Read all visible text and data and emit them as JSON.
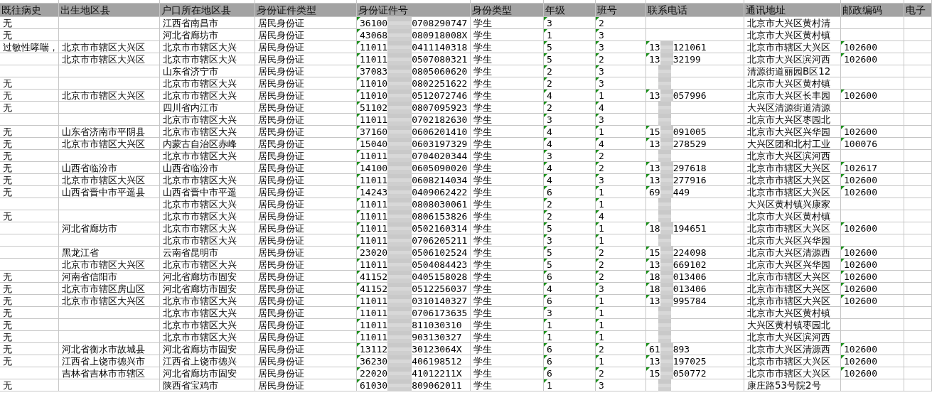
{
  "columns": [
    "既往病史",
    "出生地区县",
    "户口所在地区县",
    "身份证件类型",
    "身份证件号",
    "身份类型",
    "年级",
    "班号",
    "联系电话",
    "通讯地址",
    "邮政编码",
    "电子"
  ],
  "rows": [
    {
      "history": "无",
      "residence": "江西省南昌市",
      "id_type": "居民身份证",
      "id": {
        "prefix": "36100",
        "suffix": "0708290747"
      },
      "person_type": "学生",
      "grade": "3",
      "class": "2",
      "address": "北京市大兴区黄村清"
    },
    {
      "history": "无",
      "residence": "河北省廊坊市",
      "id_type": "居民身份证",
      "id": {
        "prefix": "43068",
        "suffix": "080918008X"
      },
      "person_type": "学生",
      "grade": "1",
      "class": "3",
      "address": "北京市大兴区黄村镇"
    },
    {
      "history": "过敏性哮喘，",
      "birthplace": "北京市市辖区大兴区",
      "residence": "北京市市辖区大兴",
      "id_type": "居民身份证",
      "id": {
        "prefix": "11011",
        "suffix": "0411140318"
      },
      "person_type": "学生",
      "grade": "5",
      "class": "3",
      "phone": {
        "masked": true,
        "prefix": "13",
        "suffix": "121061"
      },
      "address": "北京市市辖区大兴区",
      "postcode": "102600"
    },
    {
      "birthplace": "北京市市辖区大兴区",
      "residence": "北京市市辖区大兴",
      "id_type": "居民身份证",
      "id": {
        "prefix": "11011",
        "suffix": "0507080321"
      },
      "person_type": "学生",
      "grade": "5",
      "class": "2",
      "phone": {
        "masked": true,
        "prefix": "13",
        "suffix": "32199"
      },
      "address": "北京市大兴区滨河西",
      "postcode": "102600"
    },
    {
      "residence": "山东省济宁市",
      "id_type": "居民身份证",
      "id": {
        "prefix": "37083",
        "suffix": "0805060620"
      },
      "person_type": "学生",
      "grade": "2",
      "class": "3",
      "phone": {
        "masked": true
      },
      "address": "清源街道丽园B区12"
    },
    {
      "history": "无",
      "residence": "北京市市辖区大兴",
      "id_type": "居民身份证",
      "id": {
        "prefix": "11010",
        "suffix": "0802251622"
      },
      "person_type": "学生",
      "grade": "2",
      "class": "3",
      "phone": {
        "masked": true
      },
      "address": "北京市大兴区黄村镇"
    },
    {
      "history": "无",
      "birthplace": "北京市市辖区大兴区",
      "residence": "北京市市辖区大兴",
      "id_type": "居民身份证",
      "id": {
        "prefix": "11010",
        "suffix": "0512072746"
      },
      "person_type": "学生",
      "grade": "4",
      "class": "1",
      "phone": {
        "masked": true,
        "prefix": "13",
        "suffix": "057996"
      },
      "address": "北京市大兴区长丰园",
      "postcode": "102600"
    },
    {
      "history": "无",
      "residence": "四川省内江市",
      "id_type": "居民身份证",
      "id": {
        "prefix": "51102",
        "suffix": "0807095923"
      },
      "person_type": "学生",
      "grade": "2",
      "class": "4",
      "phone": {
        "masked": true
      },
      "address": "大兴区清源街道清源"
    },
    {
      "residence": "北京市市辖区大兴",
      "id_type": "居民身份证",
      "id": {
        "prefix": "11011",
        "suffix": "0702182630"
      },
      "person_type": "学生",
      "grade": "3",
      "class": "3",
      "phone": {
        "masked": true
      },
      "address": "北京市大兴区枣园北"
    },
    {
      "history": "无",
      "birthplace": "山东省济南市平阴县",
      "residence": "北京市市辖区大兴",
      "id_type": "居民身份证",
      "id": {
        "prefix": "37160",
        "suffix": "0606201410"
      },
      "person_type": "学生",
      "grade": "4",
      "class": "1",
      "phone": {
        "masked": true,
        "prefix": "15",
        "suffix": "091005"
      },
      "address": "北京市大兴区兴华园",
      "postcode": "102600"
    },
    {
      "history": "无",
      "birthplace": "北京市市辖区大兴区",
      "residence": "内蒙古自治区赤峰",
      "id_type": "居民身份证",
      "id": {
        "prefix": "15040",
        "suffix": "0603197329"
      },
      "person_type": "学生",
      "grade": "4",
      "class": "4",
      "phone": {
        "masked": true,
        "prefix": "13",
        "suffix": "278529"
      },
      "address": "大兴区团和北村工业",
      "postcode": "100076"
    },
    {
      "history": "无",
      "residence": "北京市市辖区大兴",
      "id_type": "居民身份证",
      "id": {
        "prefix": "11011",
        "suffix": "0704020344"
      },
      "person_type": "学生",
      "grade": "3",
      "class": "2",
      "phone": {
        "masked": true
      },
      "address": "北京市大兴区滨河西"
    },
    {
      "history": "无",
      "birthplace": "山西省临汾市",
      "residence": "山西省临汾市",
      "id_type": "居民身份证",
      "id": {
        "prefix": "14100",
        "suffix": "0605090020"
      },
      "person_type": "学生",
      "grade": "4",
      "class": "2",
      "phone": {
        "masked": true,
        "prefix": "13",
        "suffix": "297618"
      },
      "address": "北京市市辖区大兴区",
      "postcode": "102617"
    },
    {
      "history": "无",
      "birthplace": "北京市市辖区大兴区",
      "residence": "北京市市辖区大兴",
      "id_type": "居民身份证",
      "id": {
        "prefix": "11011",
        "suffix": "0608214034"
      },
      "person_type": "学生",
      "grade": "4",
      "class": "3",
      "phone": {
        "masked": true,
        "prefix": "13",
        "suffix": "277916"
      },
      "address": "北京市市辖区大兴区",
      "postcode": "102600"
    },
    {
      "history": "无",
      "birthplace": "山西省晋中市平遥县",
      "residence": "山西省晋中市平遥",
      "id_type": "居民身份证",
      "id": {
        "prefix": "14243",
        "suffix": "0409062422"
      },
      "person_type": "学生",
      "grade": "6",
      "class": "1",
      "phone": {
        "masked": true,
        "prefix": "69",
        "suffix": "449"
      },
      "address": "北京市市辖区大兴区",
      "postcode": "102600"
    },
    {
      "residence": "北京市市辖区大兴",
      "id_type": "居民身份证",
      "id": {
        "prefix": "11011",
        "suffix": "0808030061"
      },
      "person_type": "学生",
      "grade": "2",
      "class": "1",
      "phone": {
        "masked": true
      },
      "address": "大兴区黄村镇兴康家"
    },
    {
      "history": "无",
      "residence": "北京市市辖区大兴",
      "id_type": "居民身份证",
      "id": {
        "prefix": "11011",
        "suffix": "0806153826"
      },
      "person_type": "学生",
      "grade": "2",
      "class": "4",
      "phone": {
        "masked": true
      },
      "address": "北京市大兴区黄村镇"
    },
    {
      "birthplace": "河北省廊坊市",
      "residence": "北京市市辖区大兴",
      "id_type": "居民身份证",
      "id": {
        "prefix": "11011",
        "suffix": "0502160314"
      },
      "person_type": "学生",
      "grade": "5",
      "class": "1",
      "phone": {
        "masked": true,
        "prefix": "18",
        "suffix": "194651"
      },
      "address": "北京市市辖区大兴区",
      "postcode": "102600"
    },
    {
      "residence": "北京市市辖区大兴",
      "id_type": "居民身份证",
      "id": {
        "prefix": "11011",
        "suffix": "0706205211"
      },
      "person_type": "学生",
      "grade": "3",
      "class": "1",
      "phone": {
        "masked": true
      },
      "address": "北京市大兴区兴华园"
    },
    {
      "birthplace": "黑龙江省",
      "residence": "云南省昆明市",
      "id_type": "居民身份证",
      "id": {
        "prefix": "23020",
        "suffix": "0506102524"
      },
      "person_type": "学生",
      "grade": "5",
      "class": "2",
      "phone": {
        "masked": true,
        "prefix": "15",
        "suffix": "224098"
      },
      "address": "北京市大兴区清源西",
      "postcode": "102600"
    },
    {
      "birthplace": "北京市市辖区大兴区",
      "residence": "北京市市辖区大兴",
      "id_type": "居民身份证",
      "id": {
        "prefix": "11011",
        "suffix": "0504084423"
      },
      "person_type": "学生",
      "grade": "5",
      "class": "2",
      "phone": {
        "masked": true,
        "prefix": "13",
        "suffix": "669102"
      },
      "address": "北京市大兴区兴华园",
      "postcode": "102600"
    },
    {
      "history": "无",
      "birthplace": "河南省信阳市",
      "residence": "河北省廊坊市固安",
      "id_type": "居民身份证",
      "id": {
        "prefix": "41152",
        "suffix": "0405158028"
      },
      "person_type": "学生",
      "grade": "6",
      "class": "2",
      "phone": {
        "masked": true,
        "prefix": "18",
        "suffix": "013406"
      },
      "address": "北京市市辖区大兴区",
      "postcode": "102600"
    },
    {
      "history": "无",
      "birthplace": "北京市市辖区房山区",
      "residence": "河北省廊坊市固安",
      "id_type": "居民身份证",
      "id": {
        "prefix": "41152",
        "suffix": "0512256037"
      },
      "person_type": "学生",
      "grade": "4",
      "class": "3",
      "phone": {
        "masked": true,
        "prefix": "18",
        "suffix": "013406"
      },
      "address": "北京市市辖区大兴区",
      "postcode": "102600"
    },
    {
      "history": "无",
      "birthplace": "北京市市辖区大兴区",
      "residence": "北京市市辖区大兴",
      "id_type": "居民身份证",
      "id": {
        "prefix": "11011",
        "suffix": "0310140327"
      },
      "person_type": "学生",
      "grade": "6",
      "class": "1",
      "phone": {
        "masked": true,
        "prefix": "13",
        "suffix": "995784"
      },
      "address": "北京市市辖区大兴区",
      "postcode": "102600"
    },
    {
      "history": "无",
      "residence": "北京市市辖区大兴",
      "id_type": "居民身份证",
      "id": {
        "prefix": "11011",
        "suffix": "0706173635"
      },
      "person_type": "学生",
      "grade": "3",
      "class": "1",
      "phone": {
        "masked": true
      },
      "address": "北京市大兴区黄村镇"
    },
    {
      "history": "无",
      "residence": "北京市市辖区大兴",
      "id_type": "居民身份证",
      "id": {
        "prefix": "11011",
        "suffix": "811030310"
      },
      "person_type": "学生",
      "grade": "1",
      "class": "1",
      "phone": {
        "masked": true
      },
      "address": "大兴区黄村镇枣园北"
    },
    {
      "history": "无",
      "residence": "北京市市辖区大兴",
      "id_type": "居民身份证",
      "id": {
        "prefix": "11011",
        "suffix": "903130327"
      },
      "person_type": "学生",
      "grade": "1",
      "class": "1",
      "phone": {
        "masked": true
      },
      "address": "北京市大兴区滨河西"
    },
    {
      "history": "无",
      "birthplace": "河北省衡水市故城县",
      "residence": "河北省廊坊市固安",
      "id_type": "居民身份证",
      "id": {
        "prefix": "13112",
        "suffix": "30123064X"
      },
      "person_type": "学生",
      "grade": "6",
      "class": "2",
      "phone": {
        "masked": true,
        "prefix": "61",
        "suffix": "893"
      },
      "address": "北京市大兴区清源西",
      "postcode": "102600"
    },
    {
      "history": "无",
      "birthplace": "江西省上饶市德兴市",
      "residence": "江西省上饶市德兴",
      "id_type": "居民身份证",
      "id": {
        "prefix": "36230",
        "suffix": "406198512"
      },
      "person_type": "学生",
      "grade": "6",
      "class": "1",
      "phone": {
        "masked": true,
        "prefix": "13",
        "suffix": "197025"
      },
      "address": "北京市市辖区大兴区",
      "postcode": "102600"
    },
    {
      "birthplace": "吉林省吉林市市辖区",
      "residence": "河北省廊坊市固安",
      "id_type": "居民身份证",
      "id": {
        "prefix": "22020",
        "suffix": "41012211X"
      },
      "person_type": "学生",
      "grade": "6",
      "class": "2",
      "phone": {
        "masked": true,
        "prefix": "15",
        "suffix": "050772"
      },
      "address": "北京市市辖区大兴区",
      "postcode": "102600"
    },
    {
      "history": "无",
      "residence": "陕西省宝鸡市",
      "id_type": "居民身份证",
      "id": {
        "prefix": "61030",
        "suffix": "809062011"
      },
      "person_type": "学生",
      "grade": "1",
      "class": "3",
      "phone": {
        "masked": true
      },
      "address": "康庄路53号院2号"
    }
  ]
}
